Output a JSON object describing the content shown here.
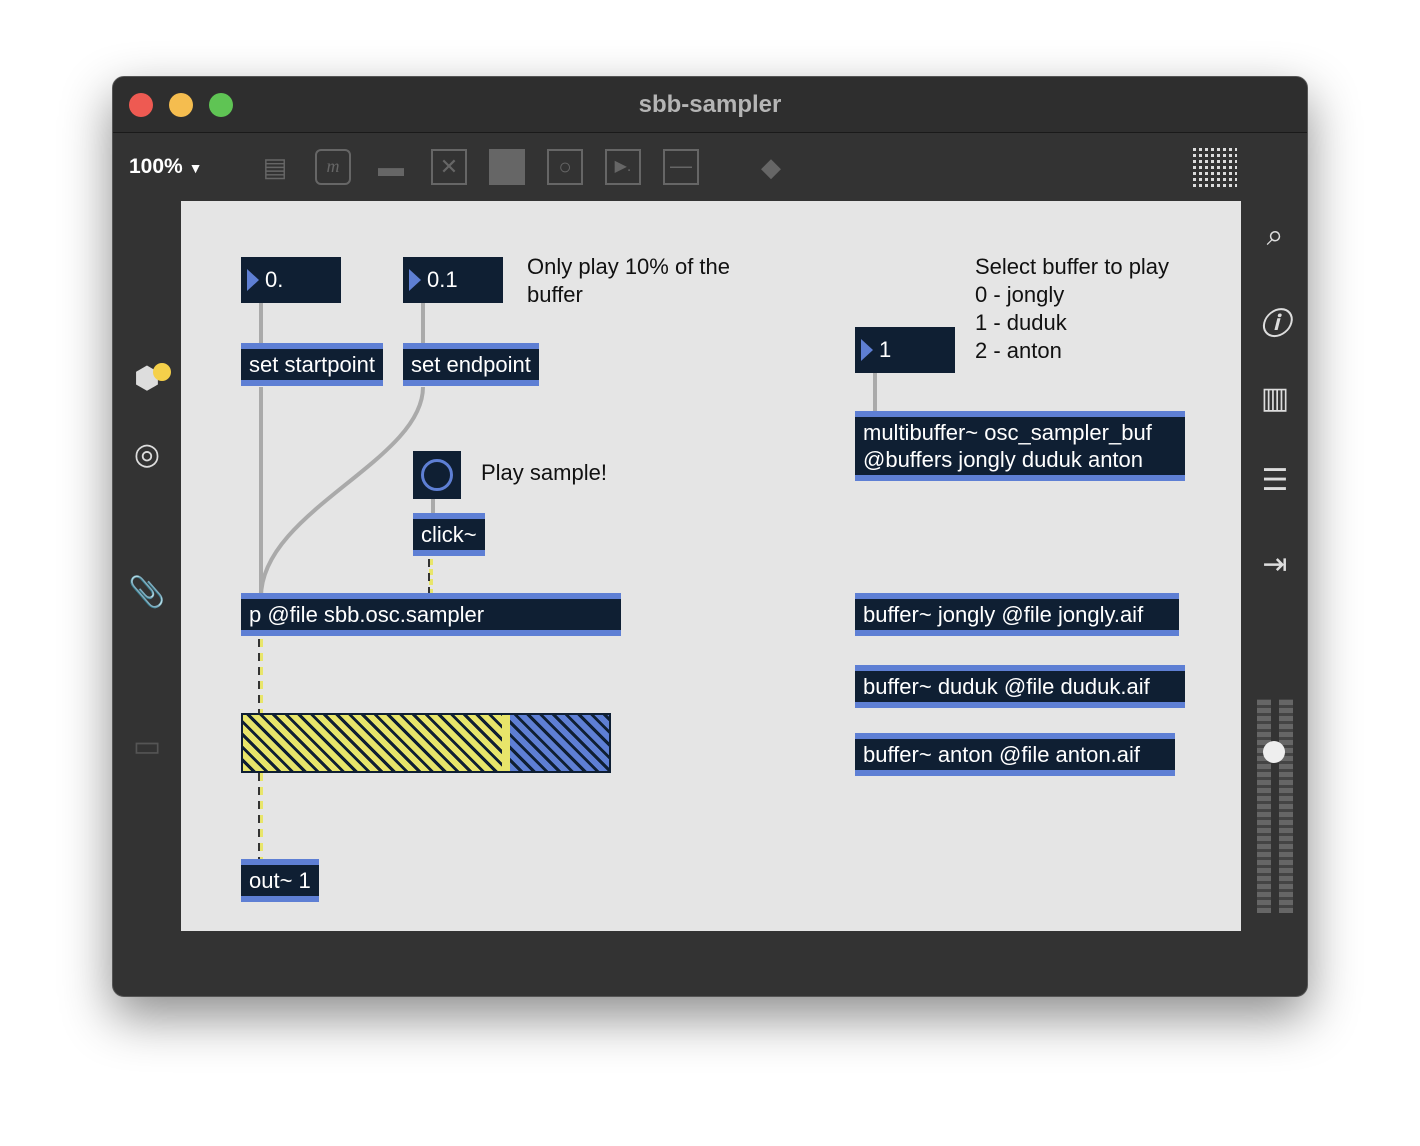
{
  "window": {
    "title": "sbb-sampler"
  },
  "toolbar": {
    "zoom": "100%",
    "icons": [
      "object-box-icon",
      "message-icon",
      "comment-icon",
      "toggle-icon",
      "matrix-icon",
      "button-icon",
      "preset-icon",
      "slider-icon",
      "paint-bucket-icon",
      "grid-icon"
    ]
  },
  "patch": {
    "num_start": "0.",
    "num_end": "0.1",
    "comment_end": "Only play 10% of the\nbuffer",
    "set_start": "set startpoint",
    "set_end": "set endpoint",
    "play_comment": "Play sample!",
    "click": "click~",
    "sampler": "p @file sbb.osc.sampler",
    "meter_level": 0.73,
    "out": "out~ 1",
    "select_comment": "Select buffer to play\n0 - jongly\n1 - duduk\n2 - anton",
    "num_buffer": "1",
    "multibuffer": "multibuffer~ osc_sampler_buf\n@buffers jongly duduk anton",
    "buf1": "buffer~ jongly @file jongly.aif",
    "buf2": "buffer~ duduk @file duduk.aif",
    "buf3": "buffer~ anton @file anton.aif"
  },
  "colors": {
    "object_bg": "#0f1f33",
    "inlet_bar": "#5e7fd4",
    "signal": "#e8e56a",
    "canvas": "#e5e5e5"
  },
  "right_sidebar": {
    "volume_level": 0.8
  }
}
